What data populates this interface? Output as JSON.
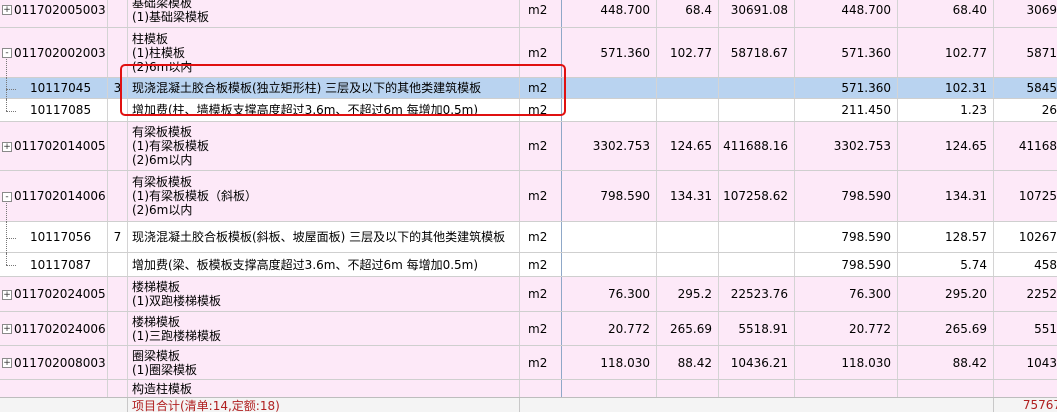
{
  "rows": [
    {
      "code": "011702005003",
      "lines": [
        "基础梁模板",
        "(1)基础梁模板"
      ],
      "unit": "m2",
      "qty": "448.700",
      "price": "68.4",
      "total": "30691.08",
      "qty2": "448.700",
      "price2": "68.40",
      "total2": "3069",
      "type": "pink",
      "expand": "+"
    },
    {
      "code": "011702002003",
      "lines": [
        "柱模板",
        "(1)柱模板",
        "(2)6m以内"
      ],
      "unit": "m2",
      "qty": "571.360",
      "price": "102.77",
      "total": "58718.67",
      "qty2": "571.360",
      "price2": "102.77",
      "total2": "5871",
      "type": "pink",
      "expand": "-"
    },
    {
      "code": "10117045",
      "idx": "3",
      "lines": [
        "现浇混凝土胶合板模板(独立矩形柱) 三层及以下的其他类建筑模板"
      ],
      "unit": "m2",
      "qty": "",
      "price": "",
      "total": "",
      "qty2": "571.360",
      "price2": "102.31",
      "total2": "5845",
      "type": "sel",
      "child": true
    },
    {
      "code": "10117085",
      "idx": "",
      "lines": [
        "增加费(柱、墙模板支撑高度超过3.6m、不超过6m 每增加0.5m)"
      ],
      "unit": "m2",
      "qty": "",
      "price": "",
      "total": "",
      "qty2": "211.450",
      "price2": "1.23",
      "total2": "26",
      "type": "white",
      "child": true,
      "last": true
    },
    {
      "code": "011702014005",
      "lines": [
        "有梁板模板",
        "(1)有梁板模板",
        "(2)6m以内"
      ],
      "unit": "m2",
      "qty": "3302.753",
      "price": "124.65",
      "total": "411688.16",
      "qty2": "3302.753",
      "price2": "124.65",
      "total2": "41168",
      "type": "pink",
      "expand": "+"
    },
    {
      "code": "011702014006",
      "lines": [
        "有梁板模板",
        "(1)有梁板模板（斜板）",
        "(2)6m以内"
      ],
      "unit": "m2",
      "qty": "798.590",
      "price": "134.31",
      "total": "107258.62",
      "qty2": "798.590",
      "price2": "134.31",
      "total2": "10725",
      "type": "pink",
      "expand": "-"
    },
    {
      "code": "10117056",
      "idx": "7",
      "lines": [
        "现浇混凝土胶合板模板(斜板、坡屋面板) 三层及以下的其他类建筑模板"
      ],
      "unit": "m2",
      "qty": "",
      "price": "",
      "total": "",
      "qty2": "798.590",
      "price2": "128.57",
      "total2": "10267",
      "type": "white",
      "child": true
    },
    {
      "code": "10117087",
      "idx": "",
      "lines": [
        "增加费(梁、板模板支撑高度超过3.6m、不超过6m 每增加0.5m)"
      ],
      "unit": "m2",
      "qty": "",
      "price": "",
      "total": "",
      "qty2": "798.590",
      "price2": "5.74",
      "total2": "458",
      "type": "white",
      "child": true,
      "last": true
    },
    {
      "code": "011702024005",
      "lines": [
        "楼梯模板",
        "(1)双跑楼梯模板"
      ],
      "unit": "m2",
      "qty": "76.300",
      "price": "295.2",
      "total": "22523.76",
      "qty2": "76.300",
      "price2": "295.20",
      "total2": "2252",
      "type": "pink",
      "expand": "+"
    },
    {
      "code": "011702024006",
      "lines": [
        "楼梯模板",
        "(1)三跑楼梯模板"
      ],
      "unit": "m2",
      "qty": "20.772",
      "price": "265.69",
      "total": "5518.91",
      "qty2": "20.772",
      "price2": "265.69",
      "total2": "551",
      "type": "pink",
      "expand": "+"
    },
    {
      "code": "011702008003",
      "lines": [
        "圈梁模板",
        "(1)圈梁模板"
      ],
      "unit": "m2",
      "qty": "118.030",
      "price": "88.42",
      "total": "10436.21",
      "qty2": "118.030",
      "price2": "88.42",
      "total2": "1043",
      "type": "pink",
      "expand": "+"
    },
    {
      "code": "",
      "lines": [
        "构造柱模板"
      ],
      "unit": "",
      "qty": "",
      "price": "",
      "total": "",
      "qty2": "",
      "price2": "",
      "total2": "",
      "type": "pink"
    }
  ],
  "footer": {
    "summary": "项目合计(清单:14,定额:18)",
    "total": "75767"
  }
}
